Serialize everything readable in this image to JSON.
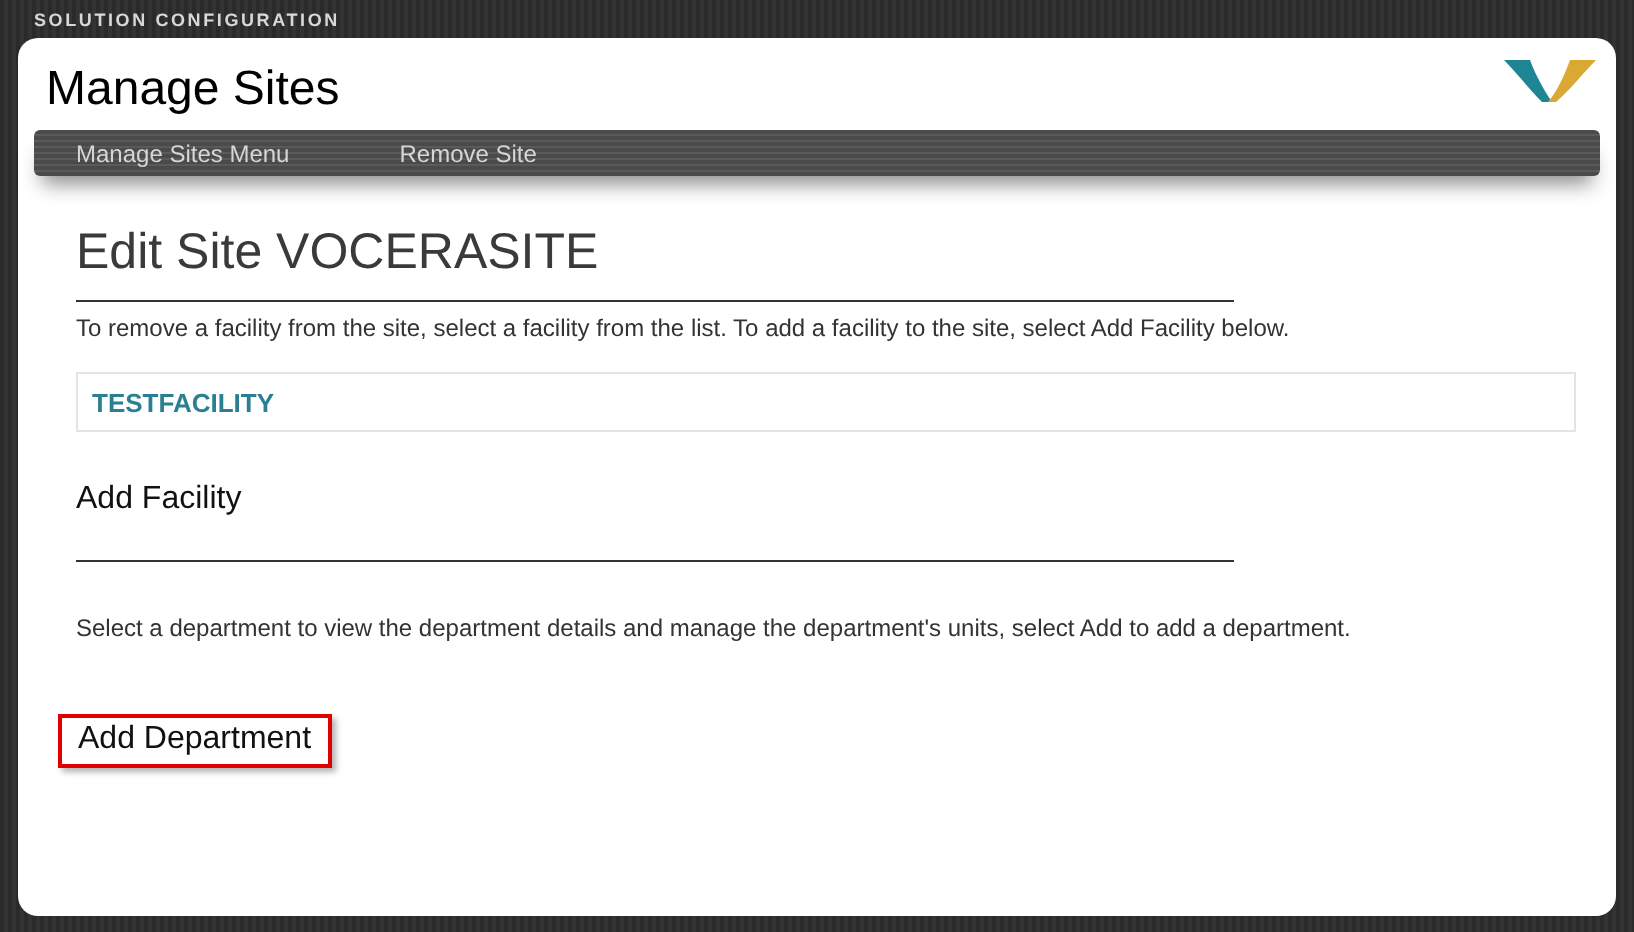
{
  "top_bar": {
    "title": "SOLUTION CONFIGURATION"
  },
  "page": {
    "title": "Manage Sites"
  },
  "menu": [
    {
      "label": "Manage Sites Menu"
    },
    {
      "label": "Remove Site"
    }
  ],
  "edit_section": {
    "heading": "Edit Site VOCERASITE",
    "description": "To remove a facility from the site, select a facility from the list. To add a facility to the site, select Add Facility below."
  },
  "facilities": [
    {
      "name": "TESTFACILITY"
    }
  ],
  "add_facility": {
    "heading": "Add Facility",
    "description": "Select a department to view the department details and manage the department's units, select Add to add a department."
  },
  "add_department_button": {
    "label": "Add Department",
    "highlighted": true
  }
}
